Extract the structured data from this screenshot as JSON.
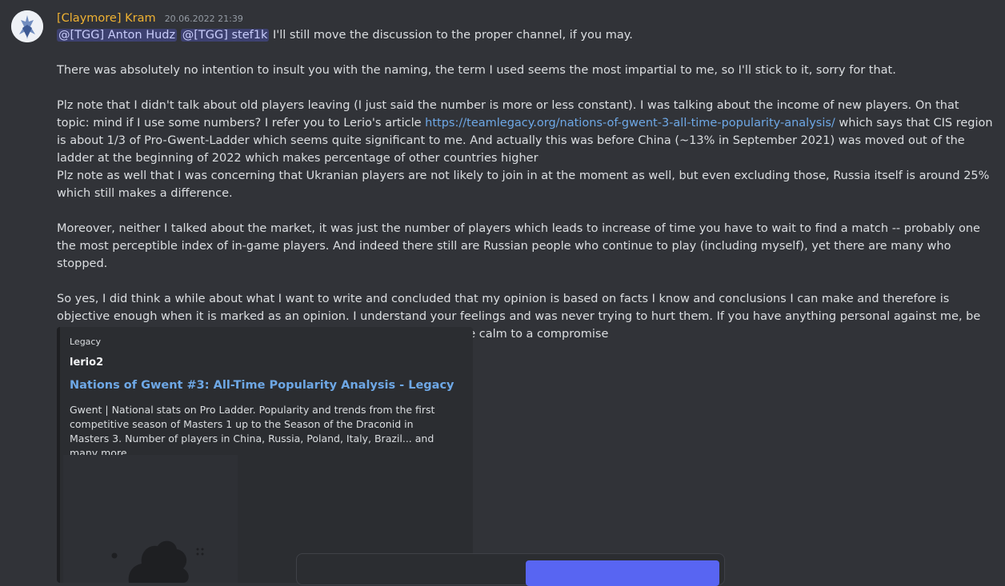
{
  "message": {
    "author": "[Claymore] Kram",
    "timestamp": "20.06.2022 21:39",
    "mentions": [
      "@[TGG] Anton Hudz",
      "@[TGG] stef1k"
    ],
    "line1_after_mentions": "I'll still move the discussion to the proper channel, if you may.",
    "paragraph2": "There was absolutely no intention to insult you with the naming, the term I used seems the most impartial to me, so I'll stick to it, sorry for that.",
    "paragraph3_before_link": "Plz note that I didn't talk about old players leaving (I just said the number is more or less constant). I was talking about the income of new players. On that topic: mind if I use some numbers? I refer you to Lerio's article",
    "paragraph3_link": "https://teamlegacy.org/nations-of-gwent-3-all-time-popularity-analysis/",
    "paragraph3_after_link": "which says that CIS region is about 1/3 of Pro-Gwent-Ladder which seems quite significant to me. And actually this was before China (~13% in September 2021) was moved out of the ladder at the beginning of 2022 which makes percentage of other countries higher",
    "paragraph3b": "Plz note as well that I was concerning that Ukranian players are not likely to join in at the moment as well, but even excluding those, Russia itself is around 25% which still makes a difference.",
    "paragraph4": "Moreover, neither I talked about the market, it was just the number of players which leads to increase of time you have to wait to find a match -- probably one the most perceptible index of in-game players. And indeed there still are Russian people who continue to play (including myself), yet there are many who stopped.",
    "paragraph5": "So yes, I did think a while about what I want to write and concluded that my opinion is based on facts I know and conclusions I can make and therefore is objective enough when it is marked as an opinion. I understand your feelings and was never trying to hurt them. If you have anything personal against me, be sure to contact me in any messenger/social network you can so that we calm to a compromise"
  },
  "embed": {
    "provider": "Legacy",
    "author": "lerio2",
    "title": "Nations of Gwent #3: All-Time Popularity Analysis - Legacy",
    "description": "Gwent | National stats on Pro Ladder. Popularity and trends from the first competitive season of Masters 1 up to the Season of the Draconid in Masters 3. Number of players in China, Russia, Poland, Italy, Brazil... and many more."
  },
  "colors": {
    "background": "#313338",
    "author": "#f0b232",
    "link": "#6ea8e6",
    "mention_bg": "#4b4f8f",
    "embed_bg": "#2b2d31",
    "button": "#5865f2"
  }
}
